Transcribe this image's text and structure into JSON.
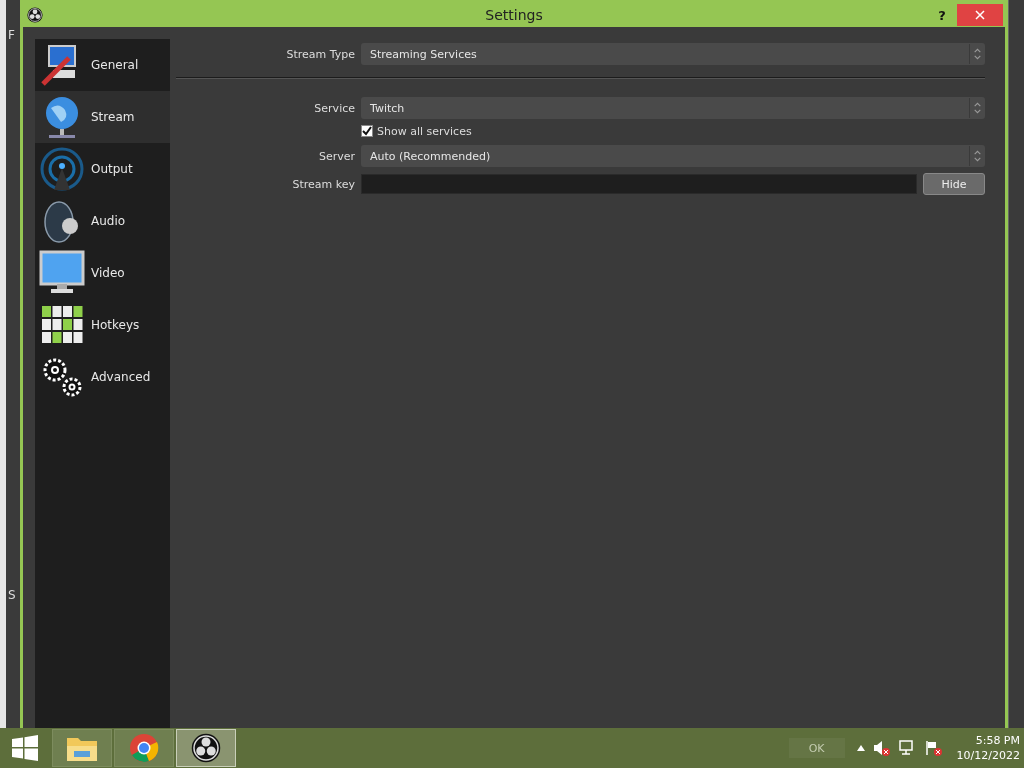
{
  "background_window": {
    "texts": [
      "F",
      "S"
    ]
  },
  "window": {
    "title": "Settings",
    "help": "?"
  },
  "sidebar": {
    "items": [
      {
        "label": "General",
        "kind": "general",
        "selected": false
      },
      {
        "label": "Stream",
        "kind": "stream",
        "selected": true
      },
      {
        "label": "Output",
        "kind": "output",
        "selected": false
      },
      {
        "label": "Audio",
        "kind": "audio",
        "selected": false
      },
      {
        "label": "Video",
        "kind": "video",
        "selected": false
      },
      {
        "label": "Hotkeys",
        "kind": "hotkeys",
        "selected": false
      },
      {
        "label": "Advanced",
        "kind": "advanced",
        "selected": false
      }
    ]
  },
  "stream_type": {
    "label": "Stream Type",
    "value": "Streaming Services"
  },
  "service": {
    "label": "Service",
    "value": "Twitch"
  },
  "show_all_services": {
    "label": "Show all services",
    "checked": true
  },
  "server": {
    "label": "Server",
    "value": "Auto (Recommended)"
  },
  "stream_key": {
    "label": "Stream key",
    "button": "Hide"
  },
  "dialog_buttons": [
    "OK"
  ],
  "taskbar": {
    "apps": [
      {
        "kind": "folder",
        "selected": false
      },
      {
        "kind": "browser",
        "selected": false
      },
      {
        "kind": "obs",
        "selected": true
      }
    ],
    "time": "5:58 PM",
    "date": "10/12/2022"
  }
}
